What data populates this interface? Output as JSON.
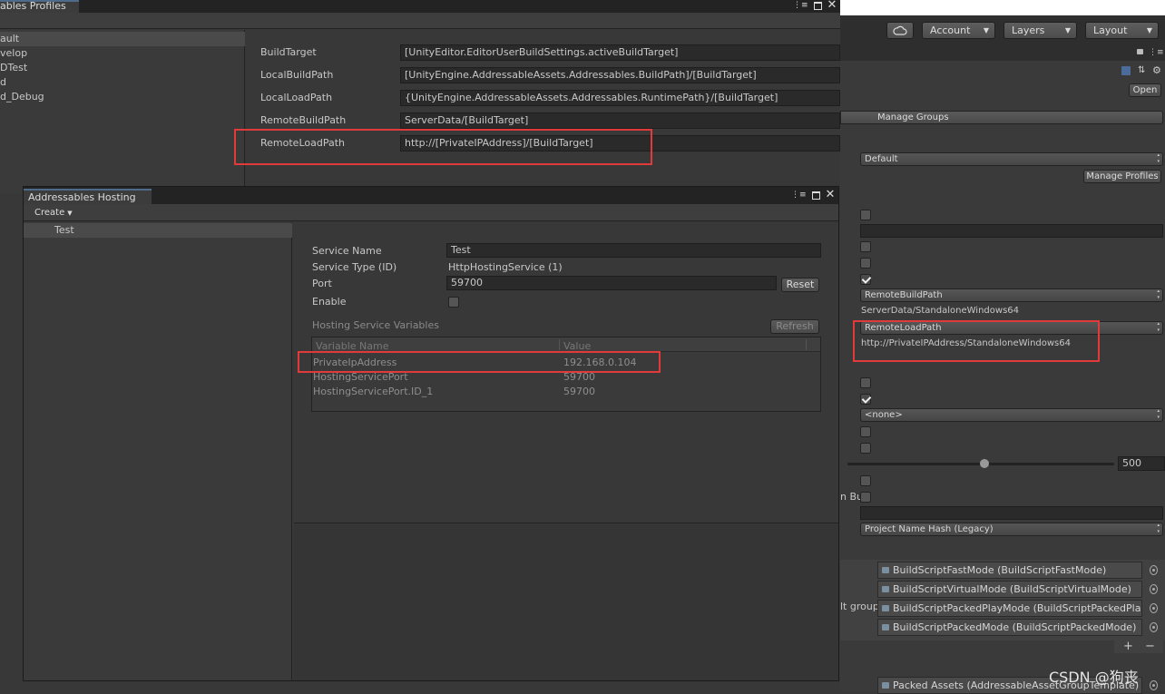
{
  "profiles_window": {
    "tab_title": "ables Profiles",
    "profiles": [
      "ault",
      "velop",
      "DTest",
      "d",
      "d_Debug"
    ],
    "variables": [
      {
        "name": "BuildTarget",
        "value": "[UnityEditor.EditorUserBuildSettings.activeBuildTarget]"
      },
      {
        "name": "LocalBuildPath",
        "value": "[UnityEngine.AddressableAssets.Addressables.BuildPath]/[BuildTarget]"
      },
      {
        "name": "LocalLoadPath",
        "value": "{UnityEngine.AddressableAssets.Addressables.RuntimePath}/[BuildTarget]"
      },
      {
        "name": "RemoteBuildPath",
        "value": "ServerData/[BuildTarget]"
      },
      {
        "name": "RemoteLoadPath",
        "value": "http://[PrivateIPAddress]/[BuildTarget]"
      }
    ]
  },
  "hosting_window": {
    "tab_title": "Addressables Hosting",
    "create_label": "Create",
    "services": [
      "Test"
    ],
    "service_name_label": "Service Name",
    "service_name_value": "Test",
    "service_type_label": "Service Type (ID)",
    "service_type_value": "HttpHostingService (1)",
    "port_label": "Port",
    "port_value": "59700",
    "reset_label": "Reset",
    "enable_label": "Enable",
    "vars_title": "Hosting Service Variables",
    "refresh_label": "Refresh",
    "col_name": "Variable Name",
    "col_value": "Value",
    "rows": [
      {
        "name": "PrivateIpAddress",
        "value": "192.168.0.104"
      },
      {
        "name": "HostingServicePort",
        "value": "59700"
      },
      {
        "name": "HostingServicePort.ID_1",
        "value": "59700"
      }
    ]
  },
  "toolbar": {
    "account_label": "Account",
    "layers_label": "Layers",
    "layout_label": "Layout"
  },
  "inspector": {
    "open_label": "Open",
    "manage_groups_label": "Manage Groups",
    "profile_dropdown": "Default",
    "manage_profiles_label": "Manage Profiles",
    "remote_build_dropdown": "RemoteBuildPath",
    "remote_build_value": "ServerData/StandaloneWindows64",
    "remote_load_dropdown": "RemoteLoadPath",
    "remote_load_value": "http://PrivateIPAddress/StandaloneWindows64",
    "none_dropdown": "<none>",
    "slider_value": "500",
    "cut_label_bu": "n Bu",
    "hash_dropdown": "Project Name Hash (Legacy)",
    "cut_label_group": "lt group",
    "build_scripts": [
      "BuildScriptFastMode (BuildScriptFastMode)",
      "BuildScriptVirtualMode (BuildScriptVirtualMode)",
      "BuildScriptPackedPlayMode (BuildScriptPackedPlayMode)",
      "BuildScriptPackedMode (BuildScriptPackedMode)"
    ],
    "plus_label": "+",
    "minus_label": "−",
    "packed_assets": "Packed Assets (AddressableAssetGroupTemplate)"
  },
  "watermark": "CSDN @狗丧",
  "colors": {
    "highlight": "#e03a3a",
    "bg": "#383838",
    "field": "#2a2a2a"
  }
}
